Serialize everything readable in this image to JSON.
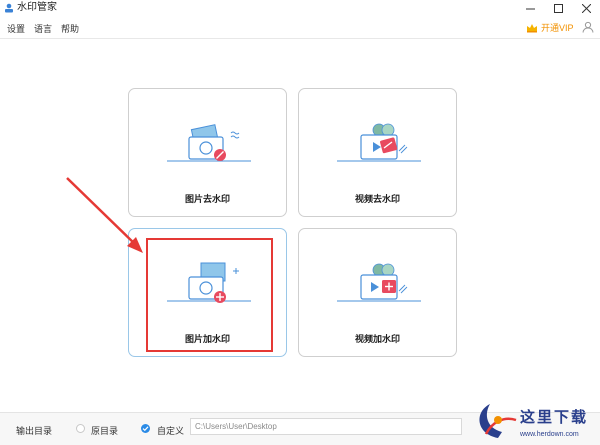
{
  "window": {
    "title": "水印管家"
  },
  "menu": {
    "settings": "设置",
    "language": "语言",
    "help": "帮助"
  },
  "vip": {
    "label": "开通VIP"
  },
  "cards": [
    {
      "label": "图片去水印"
    },
    {
      "label": "视频去水印"
    },
    {
      "label": "图片加水印"
    },
    {
      "label": "视频加水印"
    }
  ],
  "output": {
    "label": "输出目录",
    "option_source": "原目录",
    "option_custom": "自定义",
    "selected": "自定义",
    "path": "C:\\Users\\User\\Desktop"
  },
  "watermark": {
    "text": "这里下载",
    "url": "www.herdown.com"
  },
  "colors": {
    "accent": "#2b8be6",
    "vip": "#f29100",
    "annotation_red": "#e53935",
    "icon_blue": "#4a90d9"
  }
}
